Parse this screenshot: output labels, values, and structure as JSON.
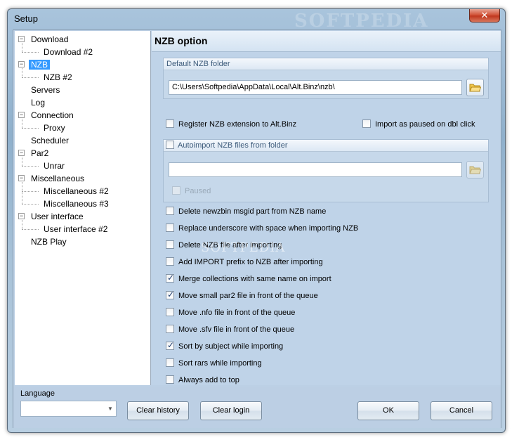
{
  "window": {
    "title": "Setup",
    "watermark": "SOFTPEDIA",
    "close_glyph": "✕"
  },
  "tree": [
    {
      "label": "Download",
      "level": 0,
      "expander": "−"
    },
    {
      "label": "Download #2",
      "level": 1
    },
    {
      "label": "NZB",
      "level": 0,
      "expander": "−",
      "selected": true
    },
    {
      "label": "NZB #2",
      "level": 1
    },
    {
      "label": "Servers",
      "level": 0
    },
    {
      "label": "Log",
      "level": 0
    },
    {
      "label": "Connection",
      "level": 0,
      "expander": "−"
    },
    {
      "label": "Proxy",
      "level": 1
    },
    {
      "label": "Scheduler",
      "level": 0
    },
    {
      "label": "Par2",
      "level": 0,
      "expander": "−"
    },
    {
      "label": "Unrar",
      "level": 1
    },
    {
      "label": "Miscellaneous",
      "level": 0,
      "expander": "−"
    },
    {
      "label": "Miscellaneous #2",
      "level": 1
    },
    {
      "label": "Miscellaneous #3",
      "level": 1
    },
    {
      "label": "User interface",
      "level": 0,
      "expander": "−"
    },
    {
      "label": "User interface #2",
      "level": 1
    },
    {
      "label": "NZB Play",
      "level": 0
    }
  ],
  "panel": {
    "title": "NZB option",
    "default_folder": {
      "header": "Default NZB folder",
      "path": "C:\\Users\\Softpedia\\AppData\\Local\\Alt.Binz\\nzb\\"
    },
    "register_ext": {
      "label": "Register NZB extension to Alt.Binz",
      "checked": false
    },
    "import_paused": {
      "label": "Import as paused on dbl click",
      "checked": false
    },
    "autoimport": {
      "header": "Autoimport NZB files from folder",
      "checked": false,
      "path": "",
      "paused": {
        "label": "Paused",
        "checked": false
      }
    },
    "options": [
      {
        "label": "Delete newzbin msgid part from NZB name",
        "checked": false
      },
      {
        "label": "Replace underscore with space when importing NZB",
        "checked": false
      },
      {
        "label": "Delete NZB file after importing",
        "checked": false
      },
      {
        "label": "Add IMPORT prefix to NZB after importing",
        "checked": false
      },
      {
        "label": "Merge collections with same name on import",
        "checked": true
      },
      {
        "label": "Move small par2 file in front of the queue",
        "checked": true
      },
      {
        "label": "Move .nfo file in front of the queue",
        "checked": false
      },
      {
        "label": "Move .sfv file in front of the queue",
        "checked": false
      },
      {
        "label": "Sort by subject while importing",
        "checked": true
      },
      {
        "label": "Sort rars while importing",
        "checked": false
      },
      {
        "label": "Always add to top",
        "checked": false
      }
    ],
    "watermark": "SOFTPEDIA"
  },
  "bottom": {
    "language_label": "Language",
    "language_value": "",
    "clear_history": "Clear history",
    "clear_login": "Clear login",
    "ok": "OK",
    "cancel": "Cancel"
  }
}
